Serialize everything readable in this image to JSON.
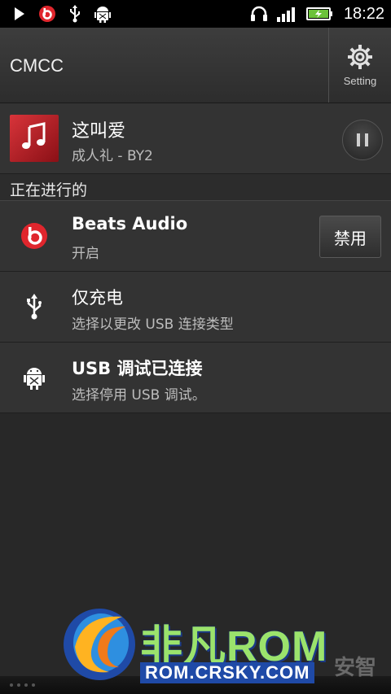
{
  "status_bar": {
    "time": "18:22"
  },
  "carrier": {
    "name": "CMCC",
    "setting_label": "Setting"
  },
  "music": {
    "title": "这叫爱",
    "subtitle": "成人礼 - BY2"
  },
  "section": {
    "title": "正在进行的"
  },
  "ongoing": [
    {
      "title": "Beats Audio",
      "subtitle": "开启",
      "action_label": "禁用",
      "icon": "beats-icon"
    },
    {
      "title": "仅充电",
      "subtitle": "选择以更改 USB 连接类型",
      "icon": "usb-icon"
    },
    {
      "title": "USB 调试已连接",
      "subtitle": "选择停用 USB 调试。",
      "icon": "android-debug-icon"
    }
  ],
  "watermark": {
    "brand": "非凡ROM",
    "url": "ROM.CRSKY.COM",
    "extra": "安智"
  },
  "colors": {
    "beats_red": "#e0262d",
    "watermark_green": "#9be36c",
    "watermark_blue": "#1f4aa7"
  }
}
